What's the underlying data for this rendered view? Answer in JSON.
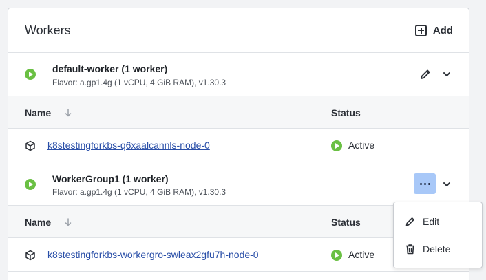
{
  "workers": {
    "title": "Workers",
    "add_label": "Add"
  },
  "groups": [
    {
      "name": "default-worker (1 worker)",
      "flavor": "Flavor: a.gp1.4g (1 vCPU, 4 GiB RAM), v1.30.3",
      "columns": {
        "name": "Name",
        "status": "Status"
      },
      "nodes": [
        {
          "name": "k8stestingforkbs-q6xaalcannls-node-0",
          "status": "Active"
        }
      ]
    },
    {
      "name": "WorkerGroup1 (1 worker)",
      "flavor": "Flavor: a.gp1.4g (1 vCPU, 4 GiB RAM), v1.30.3",
      "columns": {
        "name": "Name",
        "status": "Status"
      },
      "nodes": [
        {
          "name": "k8stestingforkbs-workergro-swleax2gfu7h-node-0",
          "status": "Active"
        }
      ]
    }
  ],
  "context_menu": {
    "edit_label": "Edit",
    "delete_label": "Delete"
  },
  "colors": {
    "active": "#6ac043",
    "link": "#2a4fa8",
    "menu_button_bg": "#a8c8f8"
  }
}
